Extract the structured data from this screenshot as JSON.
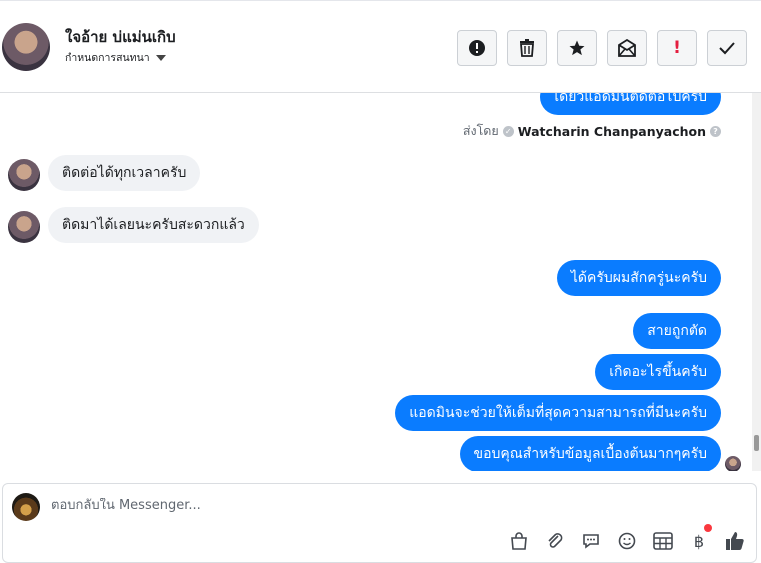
{
  "header": {
    "contact_name": "ใจอ้าย บ่แม่นเกิบ",
    "label_dropdown": "กำหนดการสนทนา",
    "actions": [
      {
        "name": "report-button",
        "icon": "alert-circle-icon"
      },
      {
        "name": "delete-button",
        "icon": "trash-icon"
      },
      {
        "name": "star-button",
        "icon": "star-icon"
      },
      {
        "name": "mark-unread-button",
        "icon": "envelope-icon"
      },
      {
        "name": "spam-button",
        "icon": "exclamation-icon",
        "glyph": "!"
      },
      {
        "name": "done-button",
        "icon": "check-icon"
      }
    ]
  },
  "chat": {
    "messages_top": {
      "partial_outgoing": "เดี๋ยวแอดมินติดต่อไปครับ",
      "sent_by_prefix": "ส่งโดย",
      "sent_by_name": "Watcharin Chanpanyachon",
      "help_glyph": "?"
    },
    "incoming": [
      "ติดต่อได้ทุกเวลาครับ",
      "ติดมาได้เลยนะครับสะดวกแล้ว"
    ],
    "outgoing": [
      "ได้ครับผมสักครู่นะครับ",
      "สายถูกตัด",
      "เกิดอะไรขึ้นครับ",
      "แอดมินจะช่วยให้เต็มที่สุดความสามารถที่มีนะครับ",
      "ขอบคุณสำหรับข้อมูลเบื้องต้นมากๆครับ"
    ]
  },
  "composer": {
    "placeholder": "ตอบกลับใน Messenger...",
    "tools": [
      "bag-icon",
      "paperclip-icon",
      "speech-bubble-icon",
      "emoji-icon",
      "table-icon",
      "baht-icon",
      "thumbs-up-icon"
    ],
    "baht_glyph": "฿"
  },
  "colors": {
    "accent": "#0a7cff",
    "incoming_bg": "#f0f2f5",
    "notification_dot": "#fa383e",
    "spam_red": "#e41e3f"
  }
}
